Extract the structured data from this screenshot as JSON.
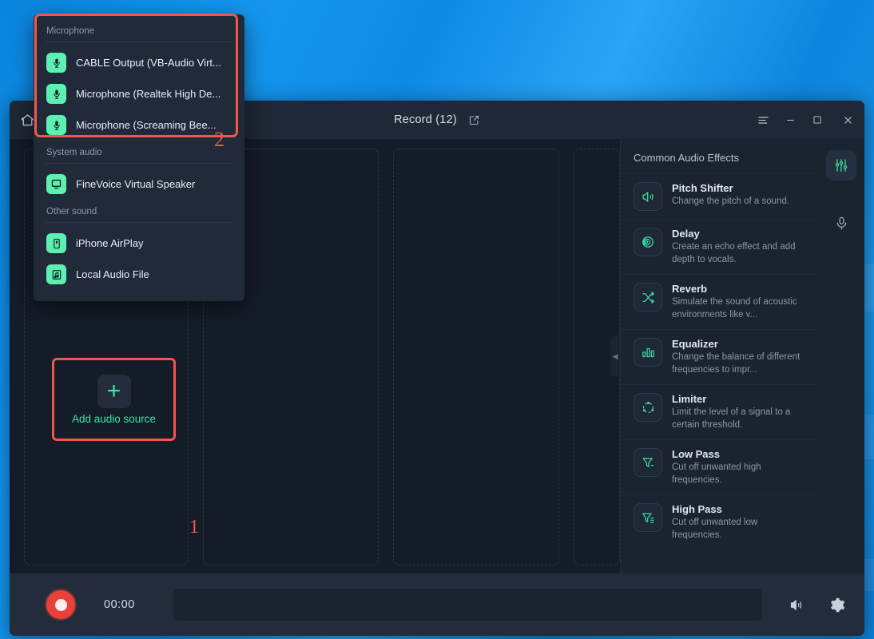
{
  "window": {
    "title": "Record (12)",
    "home_icon": "home-icon",
    "edit_icon": "edit-square-icon",
    "controls": {
      "menu_label": "≡",
      "minimize_label": "–",
      "maximize_label": "☐",
      "close_label": "✕"
    }
  },
  "stage": {
    "add_source_label": "Add audio source",
    "plus_label": "+",
    "marker_one": "1",
    "collapse_label": "◀"
  },
  "menu": {
    "sections": [
      {
        "title": "Microphone",
        "items": [
          {
            "label": "CABLE Output (VB-Audio Virt...",
            "icon": "microphone-icon"
          },
          {
            "label": "Microphone (Realtek High De...",
            "icon": "microphone-icon"
          },
          {
            "label": "Microphone (Screaming Bee...",
            "icon": "microphone-icon"
          }
        ]
      },
      {
        "title": "System audio",
        "items": [
          {
            "label": "FineVoice Virtual Speaker",
            "icon": "monitor-icon"
          }
        ]
      },
      {
        "title": "Other sound",
        "items": [
          {
            "label": "iPhone AirPlay",
            "icon": "phone-icon"
          },
          {
            "label": "Local Audio File",
            "icon": "music-file-icon"
          }
        ]
      }
    ],
    "marker_two": "2"
  },
  "effects_panel": {
    "title": "Common Audio Effects",
    "items": [
      {
        "name": "Pitch Shifter",
        "desc": "Change the pitch of a sound.",
        "icon": "speaker-icon"
      },
      {
        "name": "Delay",
        "desc": "Create an echo effect and add depth to vocals.",
        "icon": "echo-rings-icon"
      },
      {
        "name": "Reverb",
        "desc": "Simulate the sound of acoustic environments like v...",
        "icon": "shuffle-icon"
      },
      {
        "name": "Equalizer",
        "desc": "Change the balance of different frequencies to impr...",
        "icon": "bar-chart-icon"
      },
      {
        "name": "Limiter",
        "desc": "Limit the level of a signal to a certain threshold.",
        "icon": "circle-nodes-icon"
      },
      {
        "name": "Low Pass",
        "desc": "Cut off unwanted high frequencies.",
        "icon": "filter-icon"
      },
      {
        "name": "High Pass",
        "desc": "Cut off unwanted low frequencies.",
        "icon": "filter-icon"
      }
    ]
  },
  "rail": {
    "effects_icon": "sliders-icon",
    "mic_icon": "microphone-icon"
  },
  "bottom_bar": {
    "record_icon": "record-circle-icon",
    "timer": "00:00",
    "volume_icon": "volume-icon",
    "settings_icon": "gear-icon"
  },
  "colors": {
    "accent_green": "#3ddba0",
    "highlight_red": "#f2564a",
    "record_red": "#e8413a",
    "desktop_blue": "#0d8ce8"
  }
}
